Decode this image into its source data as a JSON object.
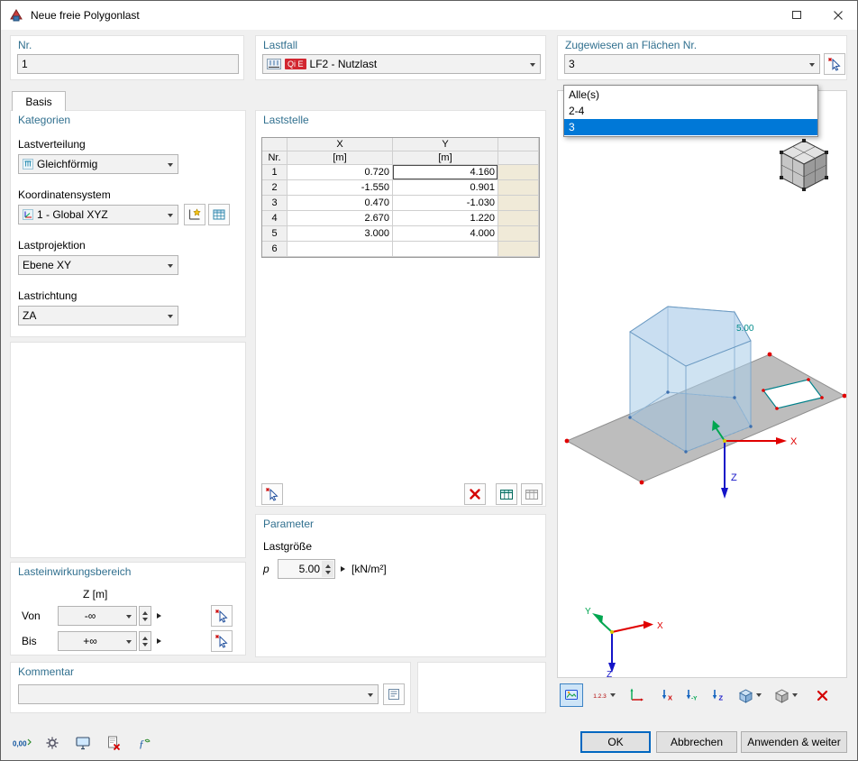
{
  "window": {
    "title": "Neue freie Polygonlast"
  },
  "header": {
    "nr": {
      "label": "Nr.",
      "value": "1"
    },
    "lastfall": {
      "label": "Lastfall",
      "badge": "Qi E",
      "value": "LF2 - Nutzlast"
    },
    "zugewiesen": {
      "label": "Zugewiesen an Flächen Nr.",
      "value": "3",
      "options": [
        {
          "label": "Alle(s)",
          "selected": false
        },
        {
          "label": "2-4",
          "selected": false
        },
        {
          "label": "3",
          "selected": true
        }
      ]
    }
  },
  "tabs": [
    {
      "label": "Basis"
    }
  ],
  "kategorien": {
    "title": "Kategorien",
    "fields": [
      {
        "label": "Lastverteilung",
        "value": "Gleichförmig"
      },
      {
        "label": "Koordinatensystem",
        "value": "1 - Global XYZ"
      },
      {
        "label": "Lastprojektion",
        "value": "Ebene XY"
      },
      {
        "label": "Lastrichtung",
        "value": "ZA"
      }
    ]
  },
  "lasteinwirkungsbereich": {
    "title": "Lasteinwirkungsbereich",
    "column_header": "Z [m]",
    "von": {
      "label": "Von",
      "value": "-∞"
    },
    "bis": {
      "label": "Bis",
      "value": "+∞"
    }
  },
  "kommentar": {
    "title": "Kommentar",
    "value": ""
  },
  "laststelle": {
    "title": "Laststelle",
    "row_header": "Nr.",
    "columns": [
      {
        "name": "X",
        "unit": "[m]"
      },
      {
        "name": "Y",
        "unit": "[m]"
      }
    ],
    "rows": [
      {
        "nr": "1",
        "x": "0.720",
        "y": "4.160"
      },
      {
        "nr": "2",
        "x": "-1.550",
        "y": "0.901"
      },
      {
        "nr": "3",
        "x": "0.470",
        "y": "-1.030"
      },
      {
        "nr": "4",
        "x": "2.670",
        "y": "1.220"
      },
      {
        "nr": "5",
        "x": "3.000",
        "y": "4.000"
      },
      {
        "nr": "6",
        "x": "",
        "y": ""
      }
    ]
  },
  "parameter": {
    "title": "Parameter",
    "section_label": "Lastgröße",
    "p_label": "p",
    "p_value": "5.00",
    "p_unit": "[kN/m²]"
  },
  "viewport": {
    "load_label": "5.00",
    "axis_x": "X",
    "axis_y": "Y",
    "axis_z": "Z"
  },
  "viewport_toolbar": {
    "numbering_label": "1.2.3",
    "view_x": "X",
    "view_y": "-Y",
    "view_z": "Z"
  },
  "bottom_toolbar": {
    "decimal_label": "0,00"
  },
  "footer": {
    "ok": "OK",
    "cancel": "Abbrechen",
    "apply": "Anwenden & weiter"
  },
  "colors": {
    "accent": "#0078d7",
    "group_title": "#31708f",
    "badge": "#d22630",
    "axis_x": "#e00000",
    "axis_y": "#00a650",
    "axis_z": "#1414c8",
    "load_label": "#008b8b",
    "selection": "#0078d7"
  }
}
